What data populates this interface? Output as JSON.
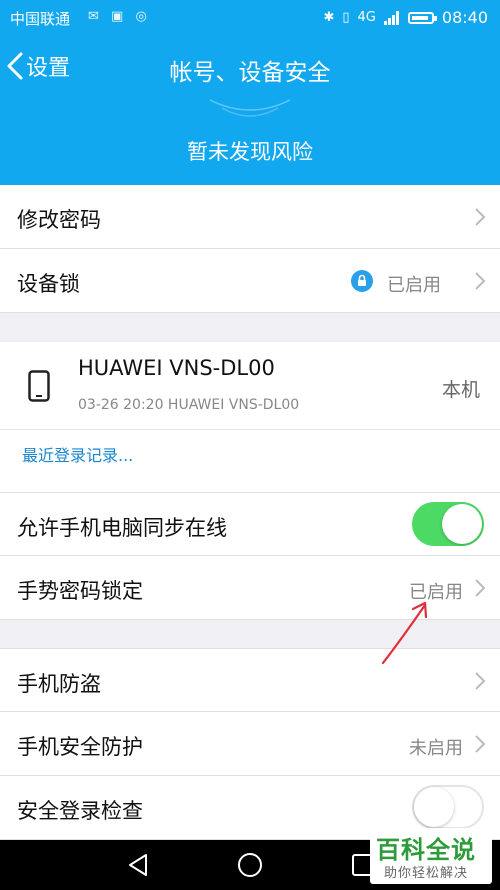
{
  "status_bar": {
    "carrier": "中国联通",
    "time": "08:40",
    "network": "4G"
  },
  "header": {
    "back_label": "设置",
    "title": "帐号、设备安全",
    "risk_text": "暂未发现风险"
  },
  "settings": {
    "change_password": "修改密码",
    "device_lock": {
      "label": "设备锁",
      "status": "已启用"
    }
  },
  "device": {
    "name": "HUAWEI VNS-DL00",
    "last_login": "03-26 20:20 HUAWEI VNS-DL00",
    "tag": "本机",
    "recent_login_link": "最近登录记录..."
  },
  "sync": {
    "label": "允许手机电脑同步在线",
    "enabled": true
  },
  "gesture": {
    "label": "手势密码锁定",
    "status": "已启用"
  },
  "protection": {
    "anti_theft": "手机防盗",
    "security_protection": {
      "label": "手机安全防护",
      "status": "未启用"
    },
    "secure_login_check": {
      "label": "安全登录检查",
      "enabled": false
    }
  },
  "watermark": {
    "main": "百科全说",
    "sub": "助你轻松解决"
  },
  "colors": {
    "primary": "#12a8f0",
    "toggle_on": "#4cd964",
    "link": "#1a86d0",
    "annotation": "#e0303a",
    "watermark_green": "#2e9b3a"
  }
}
